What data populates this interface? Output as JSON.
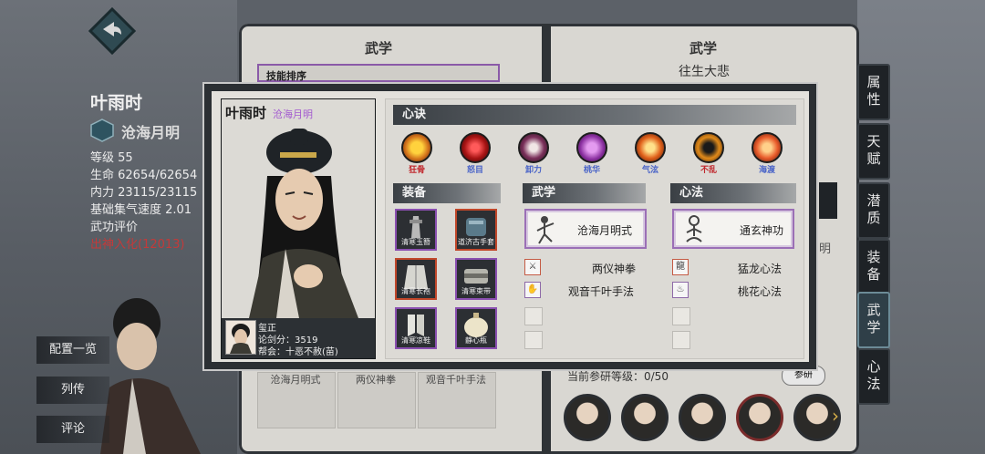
{
  "background": {
    "character": {
      "name": "叶雨时",
      "sect": "沧海月明",
      "level": "等级 55",
      "life": "生命 62654/62654",
      "inner": "内力 23115/23115",
      "speed": "基础集气速度 2.01",
      "eval_label": "武功评价",
      "eval_value": "出神入化(12013)"
    },
    "side_buttons": [
      "配置一览",
      "列传",
      "评论"
    ],
    "book": {
      "left_title": "武学",
      "left_tab": "技能排序",
      "right_title": "武学",
      "right_subtitle": "往生大悲",
      "research_label": "当前参研等级：0/50",
      "research_button": "参研",
      "bottom_cards": [
        "沧海月明式",
        "两仪神拳",
        "观音千叶手法"
      ],
      "partial_text": "明"
    },
    "tabs": [
      "属性",
      "天赋",
      "潜质",
      "装备",
      "武学",
      "心法"
    ],
    "colors": {
      "accent_purple": "#9b6fb6",
      "red_text": "#c23a3a",
      "dark_panel": "#2b2f33"
    }
  },
  "dialog": {
    "name": "叶雨时",
    "title_tag": "沧海月明",
    "player": {
      "name": "玺正",
      "score": "论剑分：3519",
      "guild": "帮会：十恶不赦(苗)"
    },
    "xinjue": {
      "header": "心诀",
      "items": [
        {
          "label": "狂骨",
          "color": "#c0262b",
          "icon": "skull-flame-icon"
        },
        {
          "label": "怒目",
          "color": "#4a64c8",
          "icon": "red-eye-icon"
        },
        {
          "label": "卸力",
          "color": "#4a64c8",
          "icon": "whirl-icon"
        },
        {
          "label": "桃华",
          "color": "#4a64c8",
          "icon": "peach-blossom-icon"
        },
        {
          "label": "气泫",
          "color": "#4a64c8",
          "icon": "fire-burst-icon"
        },
        {
          "label": "不乱",
          "color": "#c0262b",
          "icon": "meditation-icon"
        },
        {
          "label": "海渡",
          "color": "#4a64c8",
          "icon": "tide-icon"
        }
      ]
    },
    "equip": {
      "header": "装备",
      "items": [
        "清寒玉簪",
        "道济古手套",
        "清寒长袍",
        "清寒束带",
        "清寒凉鞋",
        "静心瓶"
      ]
    },
    "wuxue": {
      "header": "武学",
      "main": "沧海月明式",
      "list": [
        "两仪神拳",
        "观音千叶手法"
      ]
    },
    "xinfa": {
      "header": "心法",
      "main": "通玄神功",
      "list": [
        "猛龙心法",
        "桃花心法"
      ]
    }
  }
}
